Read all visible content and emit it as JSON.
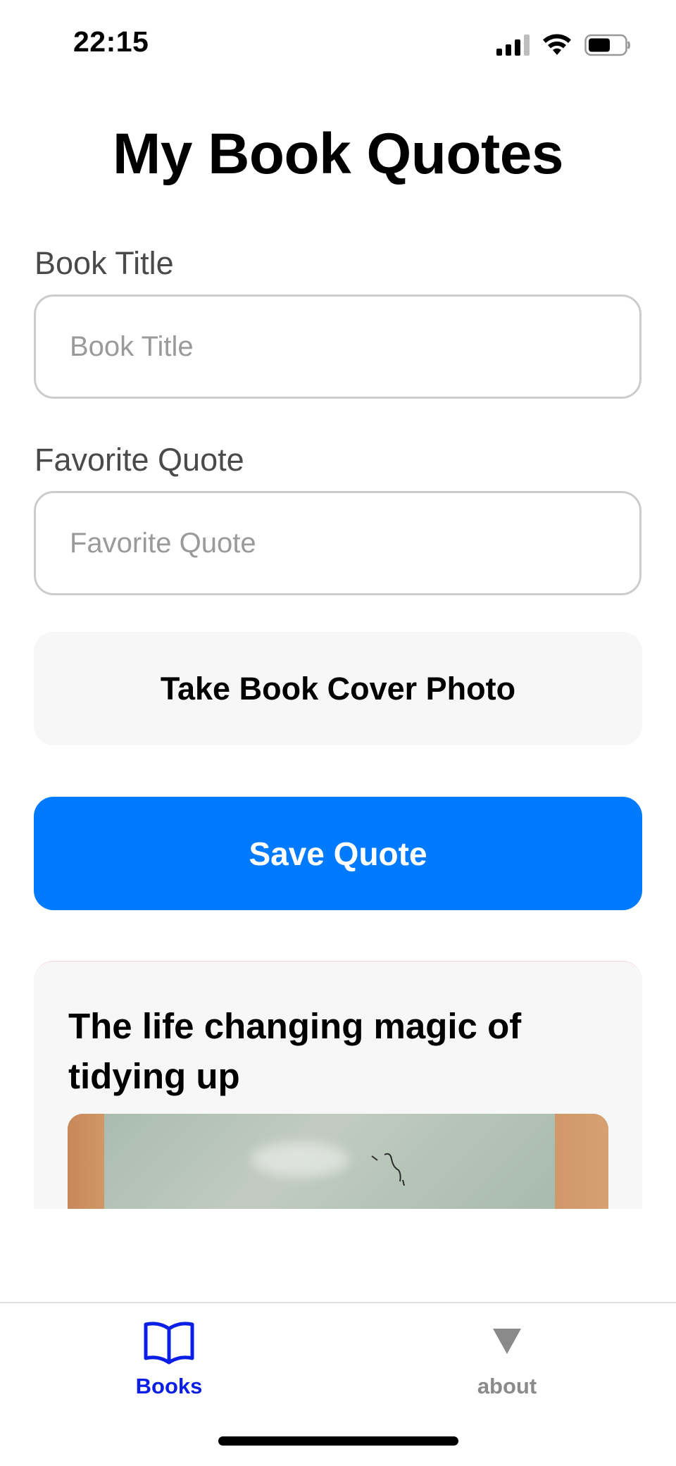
{
  "status_bar": {
    "time": "22:15",
    "icons": [
      "cellular-signal-icon",
      "wifi-icon",
      "battery-icon"
    ]
  },
  "page": {
    "title": "My Book Quotes"
  },
  "form": {
    "book_title": {
      "label": "Book Title",
      "value": "",
      "placeholder": "Book Title"
    },
    "favorite_quote": {
      "label": "Favorite Quote",
      "value": "",
      "placeholder": "Favorite Quote"
    },
    "photo_button_label": "Take Book Cover Photo",
    "save_button_label": "Save Quote"
  },
  "quotes": [
    {
      "book_title": "The life changing magic of tidying up",
      "cover_photo": "book-cover-photo"
    }
  ],
  "tab_bar": {
    "items": [
      {
        "label": "Books",
        "icon": "open-book-icon",
        "active": true
      },
      {
        "label": "about",
        "icon": "triangle-down-icon",
        "active": false
      }
    ]
  },
  "colors": {
    "accent": "#007aff",
    "active_tab": "#0a1ee6",
    "inactive_tab": "#8a8a8a",
    "input_border": "#cccccc",
    "card_background": "#f7f7f7"
  }
}
